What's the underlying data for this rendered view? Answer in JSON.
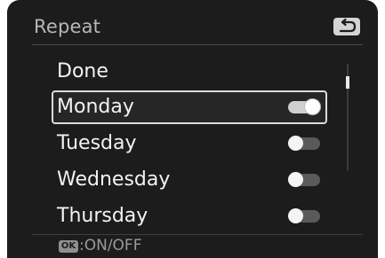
{
  "header": {
    "title": "Repeat",
    "back_icon": "return-arrow-icon"
  },
  "items": [
    {
      "label": "Done",
      "toggle": null,
      "selected": false
    },
    {
      "label": "Monday",
      "toggle": "on",
      "selected": true
    },
    {
      "label": "Tuesday",
      "toggle": "off",
      "selected": false
    },
    {
      "label": "Wednesday",
      "toggle": "off",
      "selected": false
    },
    {
      "label": "Thursday",
      "toggle": "off",
      "selected": false
    }
  ],
  "footer": {
    "ok_icon_text": "OK",
    "hint": ":ON/OFF"
  },
  "colors": {
    "background": "#1c1c1c",
    "text": "#f2f2f2",
    "title": "#b7b7b7",
    "selection_border": "#dcdcdc"
  }
}
